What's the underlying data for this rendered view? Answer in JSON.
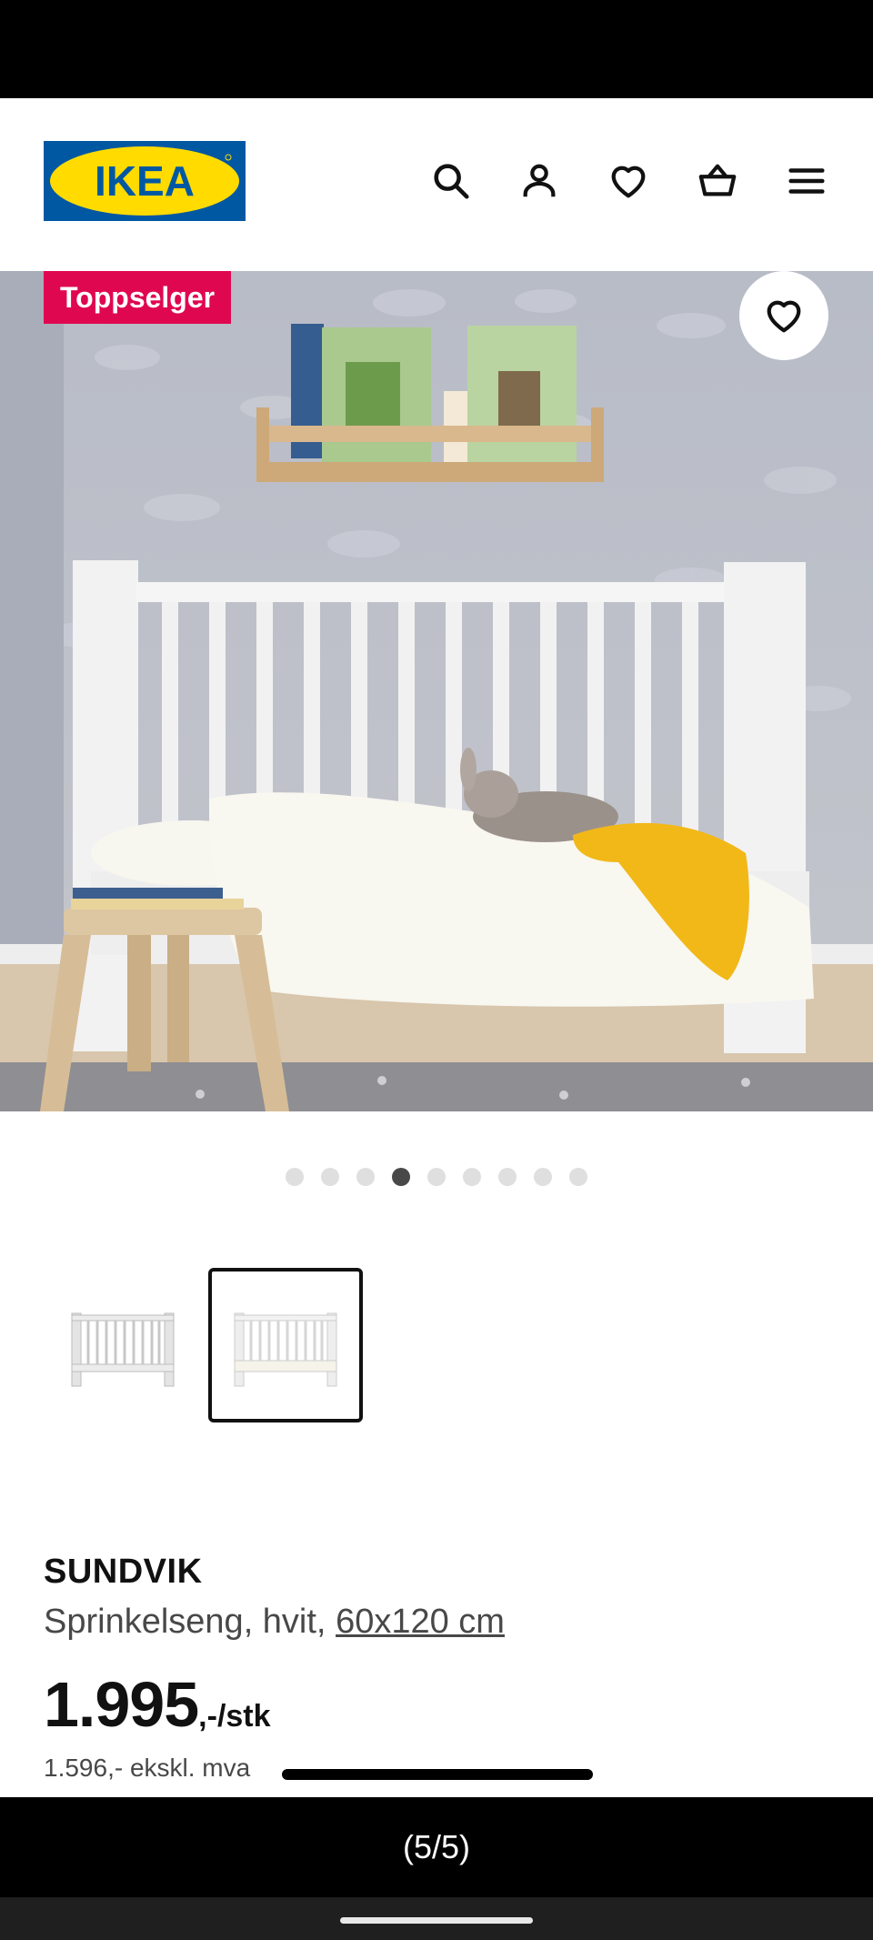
{
  "brand": {
    "logo_text": "IKEA",
    "blue": "#0058a3",
    "yellow": "#ffdb00"
  },
  "header": {
    "icons": [
      "search-icon",
      "account-icon",
      "wishlist-icon",
      "cart-icon",
      "menu-icon"
    ]
  },
  "hero": {
    "badge": "Toppselger",
    "badge_color": "#e00751",
    "favorite_icon": "heart-icon"
  },
  "carousel": {
    "total_dots": 9,
    "active_index": 3
  },
  "thumbnails": {
    "count": 2,
    "selected_index": 1
  },
  "product": {
    "name": "SUNDVIK",
    "description": "Sprinkelseng, hvit,",
    "size": "60x120 cm",
    "price": "1.995",
    "price_unit": ",-/stk",
    "price_ex_vat": "1.596,- ekskl. mva"
  },
  "footer": {
    "caption": "(5/5)"
  }
}
